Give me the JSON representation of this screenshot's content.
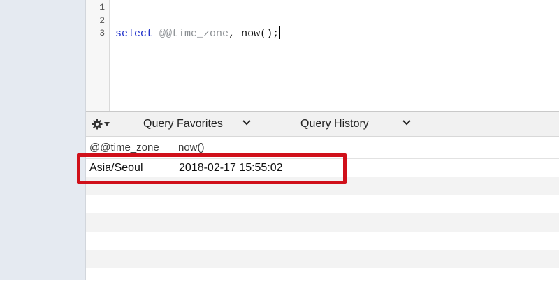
{
  "editor": {
    "line_numbers": [
      "1",
      "2",
      "3"
    ],
    "sql": {
      "keyword": "select",
      "variable": "@@time_zone",
      "rest": ", now();"
    }
  },
  "toolbar": {
    "gear_icon": "gear-icon",
    "favorites_label": "Query Favorites",
    "history_label": "Query History"
  },
  "results": {
    "columns": [
      "@@time_zone",
      "now()"
    ],
    "rows": [
      [
        "Asia/Seoul",
        "2018-02-17 15:55:02"
      ]
    ]
  },
  "colors": {
    "highlight": "#d0101a",
    "keyword": "#1b2bc9",
    "variable": "#8b8f93",
    "sidebar": "#e5eaf1"
  }
}
